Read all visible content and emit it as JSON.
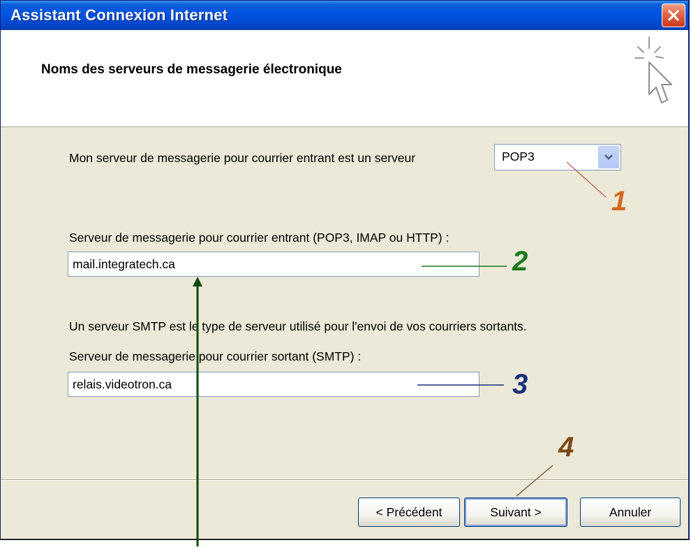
{
  "window": {
    "title": "Assistant Connexion Internet"
  },
  "header": {
    "title": "Noms des serveurs de messagerie électronique"
  },
  "incoming_type": {
    "label": "Mon serveur de messagerie pour courrier entrant est un serveur",
    "selected": "POP3"
  },
  "incoming_server": {
    "label": "Serveur de messagerie pour courrier entrant (POP3, IMAP ou HTTP) :",
    "value": "mail.integratech.ca"
  },
  "smtp_info": "Un serveur SMTP est le type de serveur utilisé pour l'envoi de vos courriers sortants.",
  "outgoing_server": {
    "label": "Serveur de messagerie pour courrier sortant (SMTP) :",
    "value": "relais.videotron.ca"
  },
  "buttons": {
    "back": "< Précédent",
    "next": "Suivant >",
    "cancel": "Annuler"
  },
  "annotations": [
    {
      "text": "1",
      "color": "#d2691e"
    },
    {
      "text": "2",
      "color": "#1a7a1a"
    },
    {
      "text": "3",
      "color": "#1a2f7a"
    },
    {
      "text": "4",
      "color": "#7a4a1a"
    }
  ],
  "colors": {
    "titlebar": "#0054e3",
    "dialog_bg": "#ece9d8",
    "close_button": "#e5694a"
  }
}
